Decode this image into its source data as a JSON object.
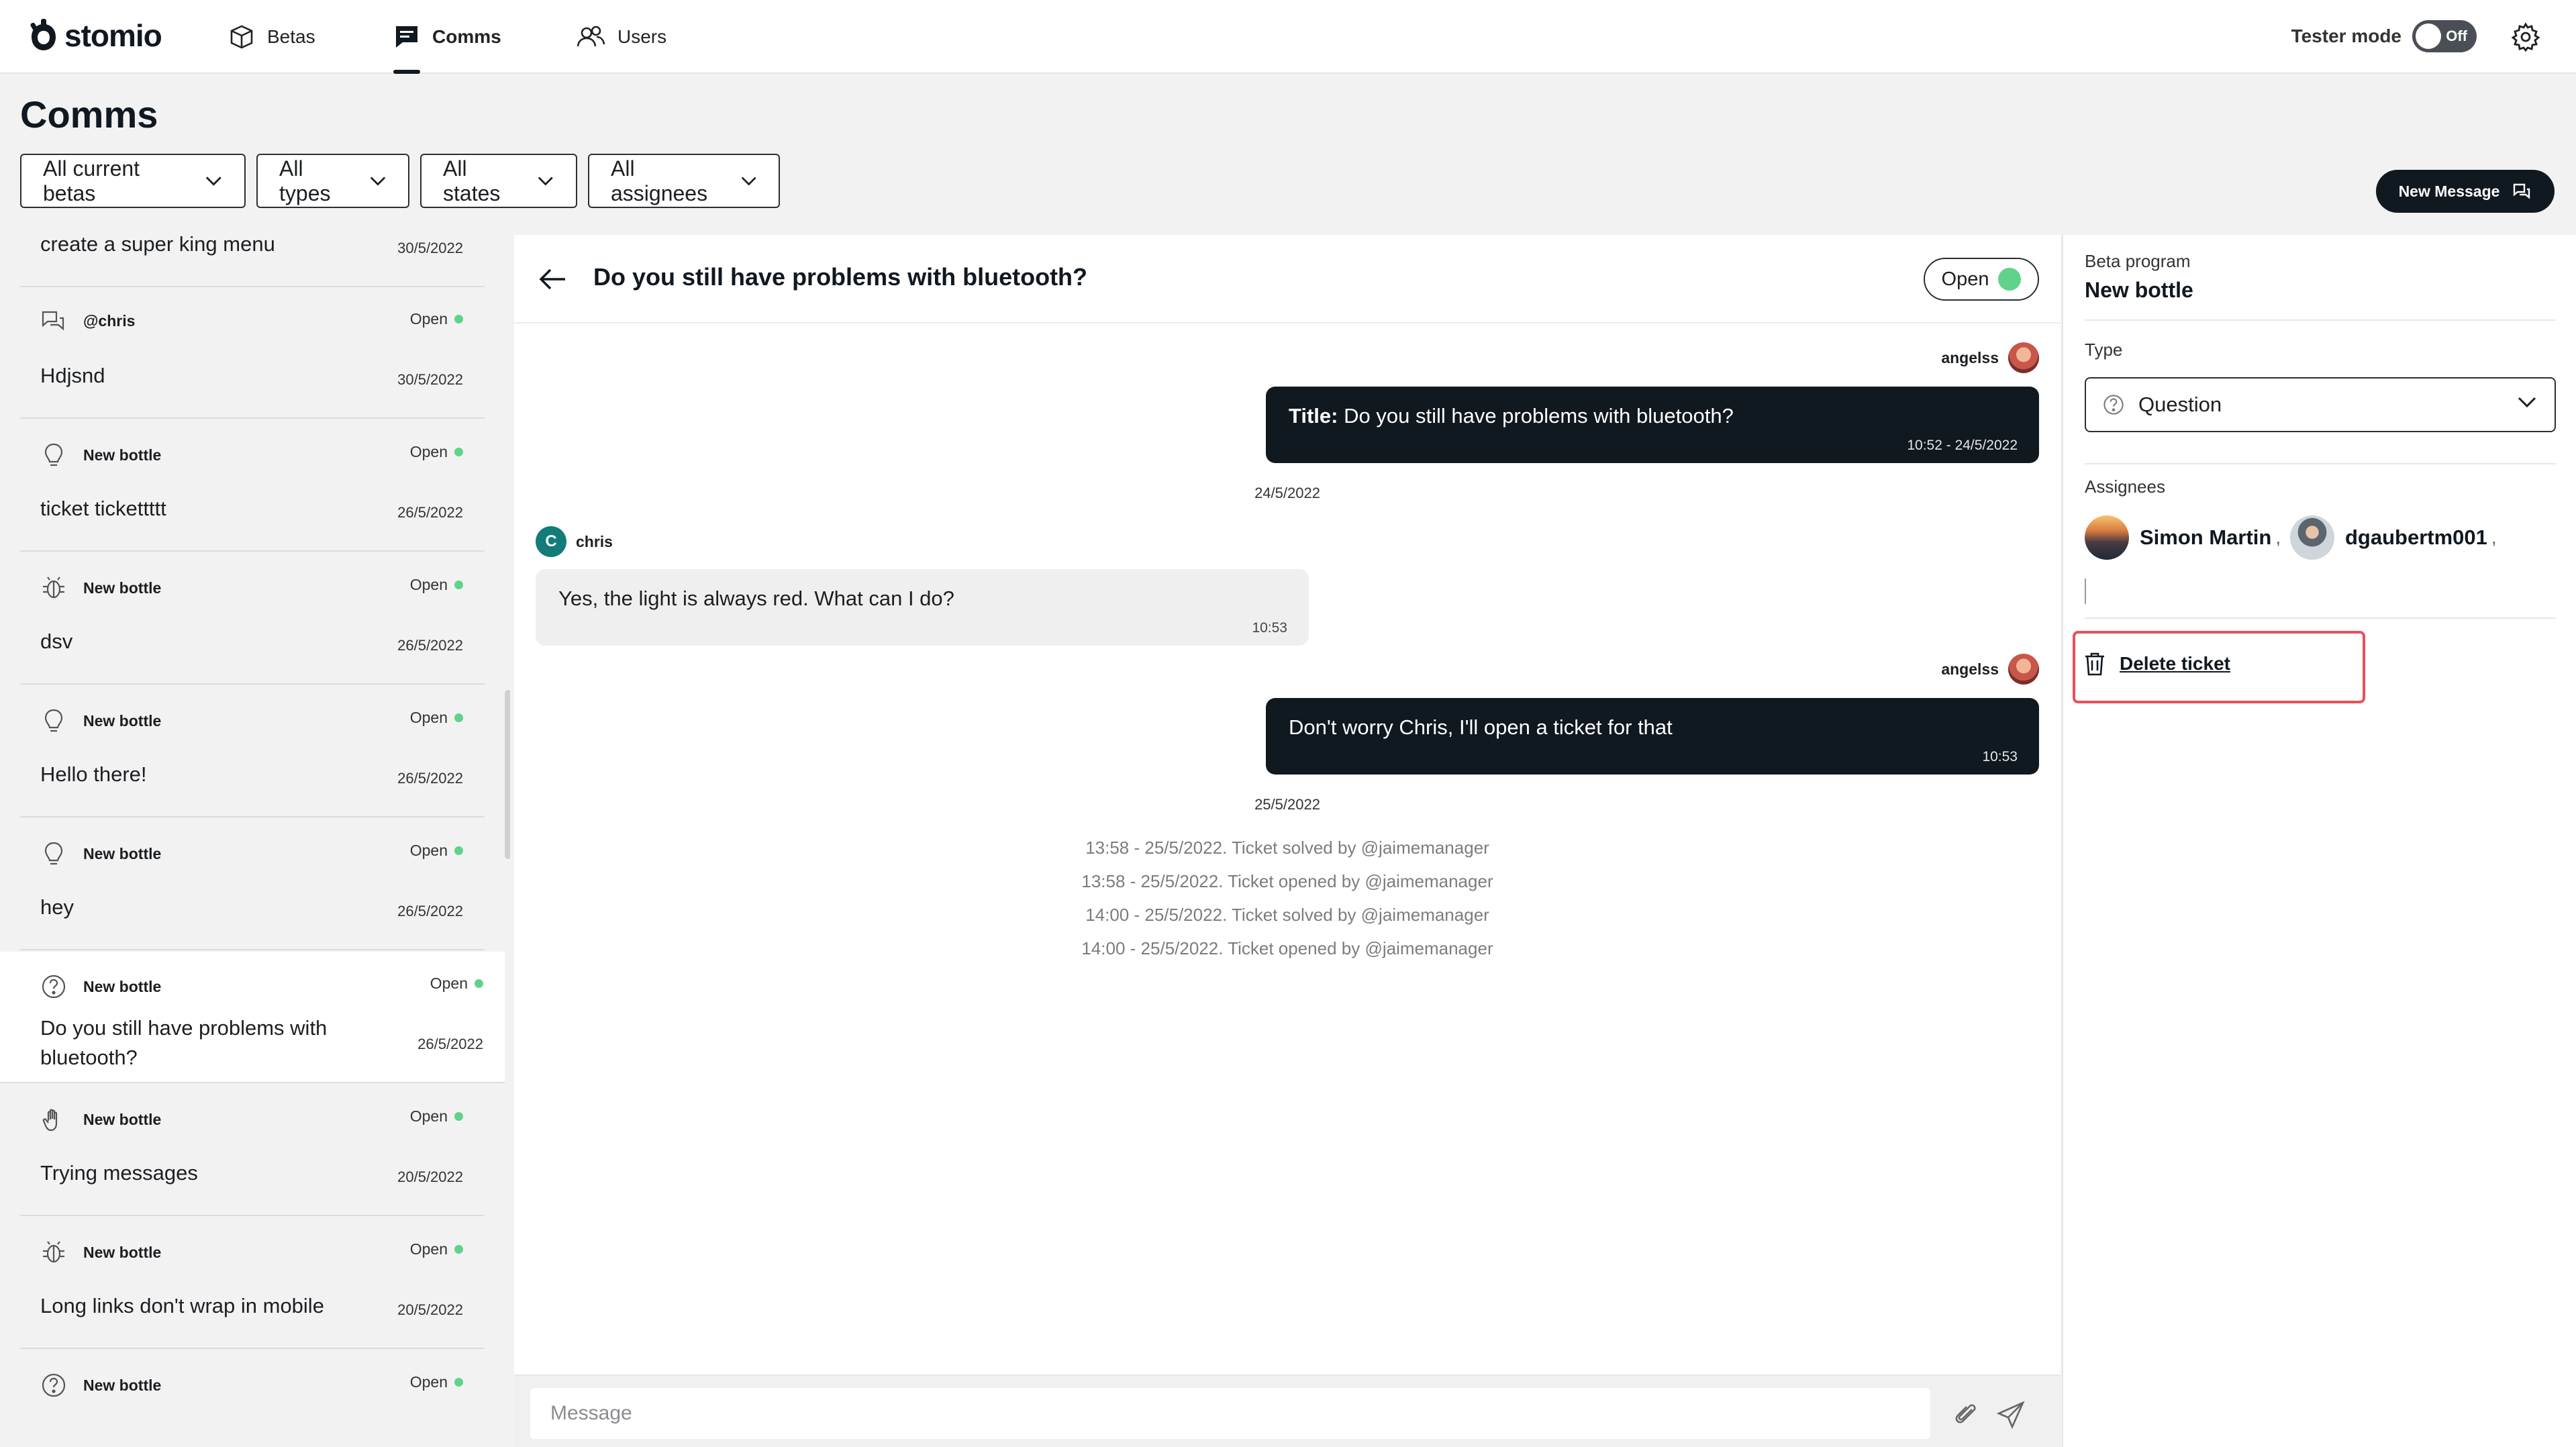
{
  "app": {
    "logo_text": "stomio"
  },
  "nav": [
    {
      "label": "Betas",
      "icon": "box-icon"
    },
    {
      "label": "Comms",
      "icon": "chat-icon",
      "active": true
    },
    {
      "label": "Users",
      "icon": "users-icon"
    }
  ],
  "header": {
    "tester_mode_label": "Tester mode",
    "tester_toggle": "Off"
  },
  "page": {
    "title": "Comms",
    "filters": [
      "All current betas",
      "All types",
      "All states",
      "All assignees"
    ],
    "new_message_label": "New Message"
  },
  "list": {
    "partial_top": {
      "title": "create a super king menu",
      "date": "30/5/2022"
    },
    "items": [
      {
        "icon": "chat-bubbles-icon",
        "program": "@chris",
        "state": "Open",
        "title": "Hdjsnd",
        "date": "30/5/2022"
      },
      {
        "icon": "lightbulb-icon",
        "program": "New bottle",
        "state": "Open",
        "title": "ticket tickettttt",
        "date": "26/5/2022"
      },
      {
        "icon": "bug-icon",
        "program": "New bottle",
        "state": "Open",
        "title": "dsv",
        "date": "26/5/2022"
      },
      {
        "icon": "lightbulb-icon",
        "program": "New bottle",
        "state": "Open",
        "title": "Hello there!",
        "date": "26/5/2022"
      },
      {
        "icon": "lightbulb-icon",
        "program": "New bottle",
        "state": "Open",
        "title": "hey",
        "date": "26/5/2022"
      },
      {
        "icon": "question-icon",
        "program": "New bottle",
        "state": "Open",
        "title": "Do you still have problems with bluetooth?",
        "date": "26/5/2022",
        "selected": true
      },
      {
        "icon": "hand-icon",
        "program": "New bottle",
        "state": "Open",
        "title": "Trying messages",
        "date": "20/5/2022"
      },
      {
        "icon": "bug-icon",
        "program": "New bottle",
        "state": "Open",
        "title": "Long links don't wrap in mobile",
        "date": "20/5/2022"
      },
      {
        "icon": "question-icon",
        "program": "New bottle",
        "state": "Open",
        "title": "",
        "date": ""
      }
    ]
  },
  "chat": {
    "title": "Do you still have problems with bluetooth?",
    "status": "Open",
    "messages": [
      {
        "author": "angelss",
        "title_prefix": "Title:",
        "text": "Do you still have problems with bluetooth?",
        "time": "10:52 - 24/5/2022"
      },
      {
        "author": "chris",
        "avatar_letter": "C",
        "text": "Yes, the light is always red. What can I do?",
        "time": "10:53"
      },
      {
        "author": "angelss",
        "text": "Don't worry Chris, I'll open a ticket for that",
        "time": "10:53"
      }
    ],
    "day_separators": [
      "24/5/2022",
      "25/5/2022"
    ],
    "log": [
      "13:58 - 25/5/2022. Ticket solved by @jaimemanager",
      "13:58 - 25/5/2022. Ticket opened by @jaimemanager",
      "14:00 - 25/5/2022. Ticket solved by @jaimemanager",
      "14:00 - 25/5/2022. Ticket opened by @jaimemanager"
    ],
    "composer_placeholder": "Message"
  },
  "details": {
    "beta_program_label": "Beta program",
    "beta_program_value": "New bottle",
    "type_label": "Type",
    "type_value": "Question",
    "assignees_label": "Assignees",
    "assignees": [
      "Simon Martin",
      "dgaubertm001"
    ],
    "delete_label": "Delete ticket"
  },
  "colors": {
    "brand_dark": "#101820",
    "status_open": "#5fd38a",
    "danger": "#e8505b",
    "avatar_chris": "#127c79"
  }
}
